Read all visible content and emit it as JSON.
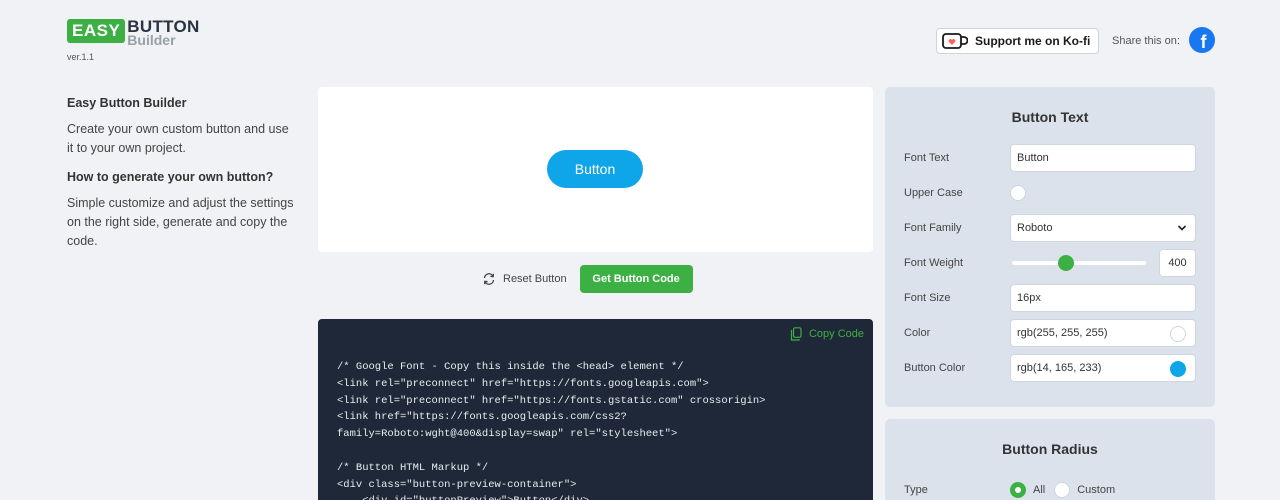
{
  "header": {
    "logo_easy": "EASY",
    "logo_button": "BUTTON",
    "logo_builder": "Builder",
    "version": "ver.1.1",
    "kofi_label": "Support me on Ko-fi",
    "share_label": "Share this on:",
    "share_icon": "facebook-icon"
  },
  "info": {
    "title": "Easy Button Builder",
    "description": "Create your own custom button and use it to your own project.",
    "how_title": "How to generate your own button?",
    "how_text": "Simple customize and adjust the settings on the right side, generate and copy the code."
  },
  "preview": {
    "button_label": "Button",
    "button_color": "#0ea5e9"
  },
  "actions": {
    "reset_label": "Reset Button",
    "get_code_label": "Get Button Code"
  },
  "code": {
    "copy_label": "Copy Code",
    "content": "/* Google Font - Copy this inside the <head> element */\n<link rel=\"preconnect\" href=\"https://fonts.googleapis.com\">\n<link rel=\"preconnect\" href=\"https://fonts.gstatic.com\" crossorigin>\n<link href=\"https://fonts.googleapis.com/css2?\nfamily=Roboto:wght@400&display=swap\" rel=\"stylesheet\">\n\n/* Button HTML Markup */\n<div class=\"button-preview-container\">\n    <div id=\"buttonPreview\">Button</div>"
  },
  "button_text_panel": {
    "title": "Button Text",
    "font_text_label": "Font Text",
    "font_text_value": "Button",
    "upper_case_label": "Upper Case",
    "font_family_label": "Font Family",
    "font_family_value": "Roboto",
    "font_weight_label": "Font Weight",
    "font_weight_value": "400",
    "font_weight_level": 0.4,
    "font_size_label": "Font Size",
    "font_size_value": "16px",
    "color_label": "Color",
    "color_value": "rgb(255, 255, 255)",
    "button_color_label": "Button Color",
    "button_color_value": "rgb(14, 165, 233)"
  },
  "button_radius_panel": {
    "title": "Button Radius",
    "type_label": "Type",
    "option_all": "All",
    "option_custom": "Custom"
  },
  "colors": {
    "accent_green": "#3cb043",
    "button_blue": "#0ea5e9",
    "code_bg": "#1e2838",
    "panel_bg": "#dbe2eb"
  }
}
